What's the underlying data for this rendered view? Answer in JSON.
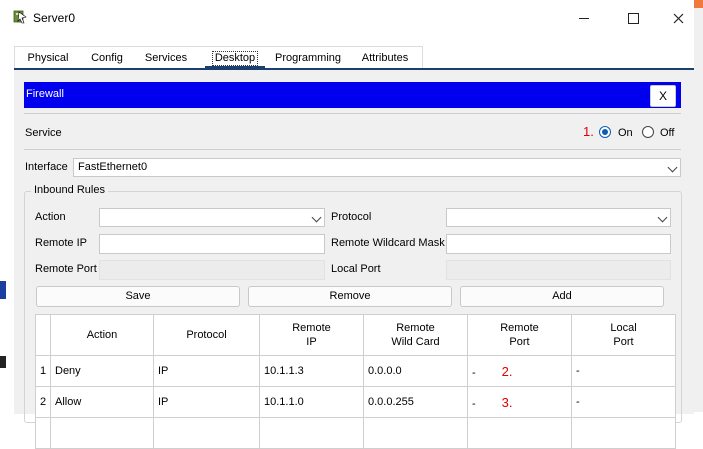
{
  "window": {
    "title": "Server0",
    "minimize_icon": "minimize-icon",
    "maximize_icon": "maximize-icon",
    "close_icon": "close-icon"
  },
  "tabs": [
    "Physical",
    "Config",
    "Services",
    "Desktop",
    "Programming",
    "Attributes"
  ],
  "active_tab": "Desktop",
  "firewall": {
    "title": "Firewall",
    "close_label": "X",
    "service_label": "Service",
    "service_on_label": "On",
    "service_off_label": "Off",
    "service_state": "On",
    "interface_label": "Interface",
    "interface_value": "FastEthernet0",
    "inbound_rules_title": "Inbound Rules",
    "action_label": "Action",
    "action_value": "",
    "protocol_label": "Protocol",
    "protocol_value": "",
    "remote_ip_label": "Remote IP",
    "remote_ip_value": "",
    "remote_wildcard_label": "Remote Wildcard Mask",
    "remote_wildcard_value": "",
    "remote_port_label": "Remote Port",
    "local_port_label": "Local Port",
    "save_label": "Save",
    "remove_label": "Remove",
    "add_label": "Add",
    "table": {
      "headers": [
        "",
        "Action",
        "Protocol",
        "Remote\nIP",
        "Remote\nWild Card",
        "Remote\nPort",
        "Local\nPort"
      ],
      "rows": [
        [
          "1",
          "Deny",
          "IP",
          "10.1.1.3",
          "0.0.0.0",
          "-",
          "-"
        ],
        [
          "2",
          "Allow",
          "IP",
          "10.1.1.0",
          "0.0.0.255",
          "-",
          "-"
        ]
      ]
    }
  },
  "annotations": {
    "a1": "1.",
    "a2": "2.",
    "a3": "3."
  },
  "colors": {
    "header_blue": "#0000ee",
    "accent_red": "#e00000",
    "radio_blue": "#0a5cb8",
    "tab_underline": "#1b3f6e"
  }
}
